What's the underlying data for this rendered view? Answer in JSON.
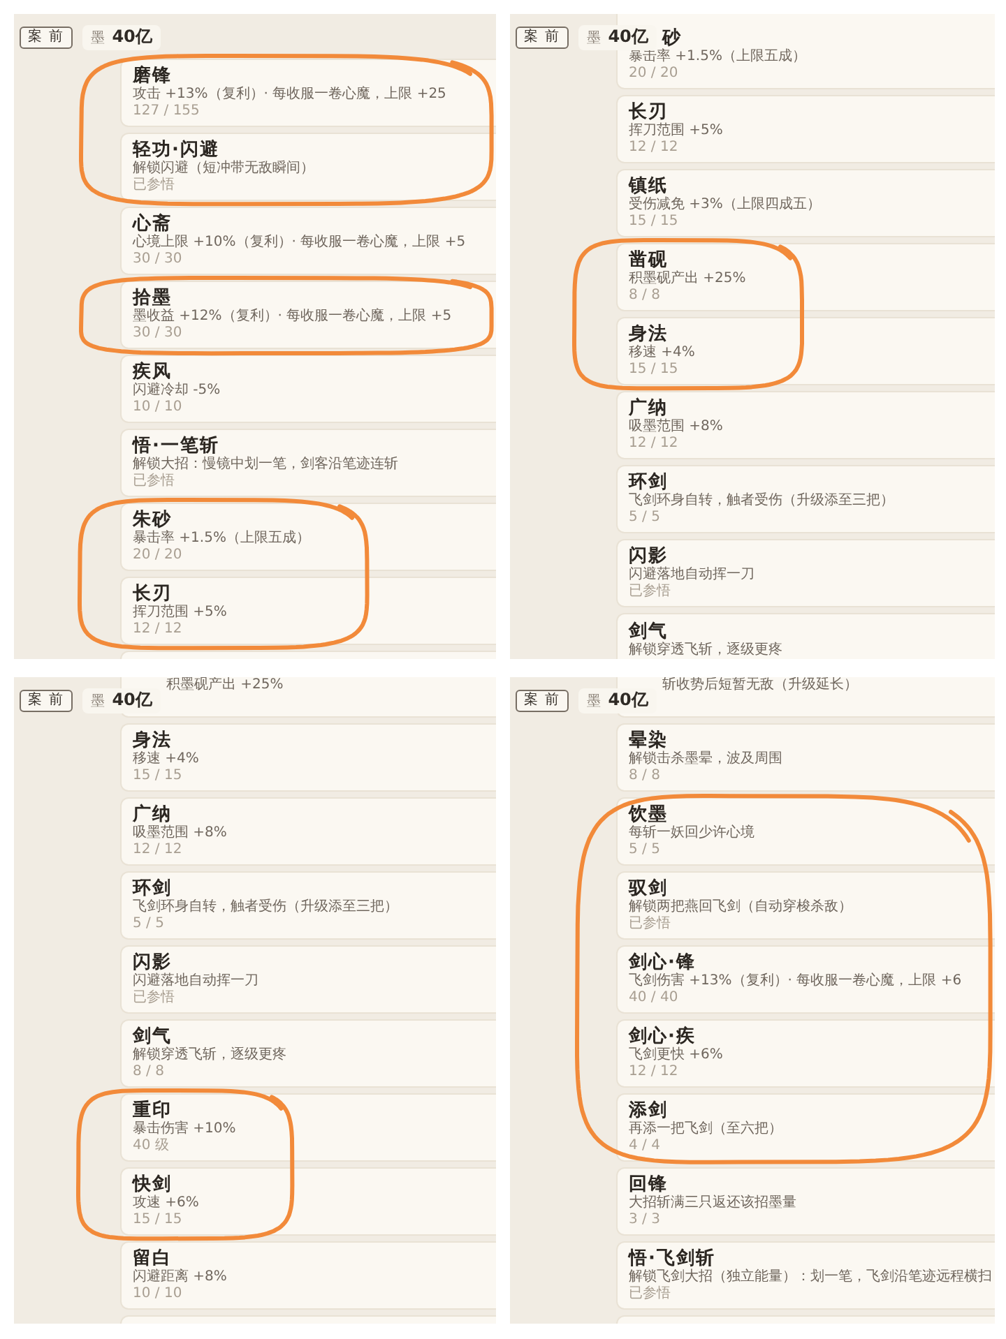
{
  "panels": [
    {
      "nav_button": "案 前",
      "ink": {
        "label": "墨",
        "amount": "40亿"
      },
      "cards": [
        {
          "kind": "full",
          "title": "磨锋",
          "desc": "攻击 +13%（复利）· 每收服一卷心魔，上限 +25",
          "progress": "127 / 155",
          "circled": true
        },
        {
          "kind": "full",
          "title": "轻功·闪避",
          "desc": "解锁闪避（短冲带无敌瞬间）",
          "progress": "已参悟",
          "circled": true
        },
        {
          "kind": "full",
          "title": "心斋",
          "desc": "心境上限 +10%（复利）· 每收服一卷心魔，上限 +5",
          "progress": "30 / 30",
          "circled": false
        },
        {
          "kind": "full",
          "title": "拾墨",
          "desc": "墨收益 +12%（复利）· 每收服一卷心魔，上限 +5",
          "progress": "30 / 30",
          "circled": true
        },
        {
          "kind": "full",
          "title": "疾风",
          "desc": "闪避冷却 -5%",
          "progress": "10 / 10",
          "circled": false
        },
        {
          "kind": "full",
          "title": "悟·一笔斩",
          "desc": "解锁大招：慢镜中划一笔，剑客沿笔迹连斩",
          "progress": "已参悟",
          "circled": false
        },
        {
          "kind": "full",
          "title": "朱砂",
          "desc": "暴击率 +1.5%（上限五成）",
          "progress": "20 / 20",
          "circled": true
        },
        {
          "kind": "full",
          "title": "长刃",
          "desc": "挥刀范围 +5%",
          "progress": "12 / 12",
          "circled": true
        },
        {
          "kind": "bottom-cut",
          "circled": false
        }
      ]
    },
    {
      "nav_button": "案 前",
      "ink": {
        "label": "墨",
        "amount": "40亿"
      },
      "cards": [
        {
          "kind": "top-cut",
          "title": "砂",
          "desc": "暴击率 +1.5%（上限五成）",
          "progress": "20 / 20",
          "circled": false
        },
        {
          "kind": "full",
          "title": "长刃",
          "desc": "挥刀范围 +5%",
          "progress": "12 / 12",
          "circled": false
        },
        {
          "kind": "full",
          "title": "镇纸",
          "desc": "受伤减免 +3%（上限四成五）",
          "progress": "15 / 15",
          "circled": false
        },
        {
          "kind": "full",
          "title": "凿砚",
          "desc": "积墨砚产出 +25%",
          "progress": "8 / 8",
          "circled": true
        },
        {
          "kind": "full",
          "title": "身法",
          "desc": "移速 +4%",
          "progress": "15 / 15",
          "circled": true
        },
        {
          "kind": "full",
          "title": "广纳",
          "desc": "吸墨范围 +8%",
          "progress": "12 / 12",
          "circled": false
        },
        {
          "kind": "full",
          "title": "环剑",
          "desc": "飞剑环身自转，触者受伤（升级添至三把）",
          "progress": "5 / 5",
          "circled": false
        },
        {
          "kind": "full",
          "title": "闪影",
          "desc": "闪避落地自动挥一刀",
          "progress": "已参悟",
          "circled": false
        },
        {
          "kind": "bottom-cut",
          "title": "剑气",
          "desc": "解锁穿透飞斩，逐级更疼",
          "circled": false
        }
      ]
    },
    {
      "nav_button": "案 前",
      "ink": {
        "label": "墨",
        "amount": "40亿"
      },
      "cards": [
        {
          "kind": "top-cut",
          "desc": "积墨砚产出 +25%",
          "circled": false
        },
        {
          "kind": "full",
          "title": "身法",
          "desc": "移速 +4%",
          "progress": "15 / 15",
          "circled": false
        },
        {
          "kind": "full",
          "title": "广纳",
          "desc": "吸墨范围 +8%",
          "progress": "12 / 12",
          "circled": false
        },
        {
          "kind": "full",
          "title": "环剑",
          "desc": "飞剑环身自转，触者受伤（升级添至三把）",
          "progress": "5 / 5",
          "circled": false
        },
        {
          "kind": "full",
          "title": "闪影",
          "desc": "闪避落地自动挥一刀",
          "progress": "已参悟",
          "circled": false
        },
        {
          "kind": "full",
          "title": "剑气",
          "desc": "解锁穿透飞斩，逐级更疼",
          "progress": "8 / 8",
          "circled": false
        },
        {
          "kind": "full",
          "title": "重印",
          "desc": "暴击伤害 +10%",
          "progress": "40 级",
          "circled": true
        },
        {
          "kind": "full",
          "title": "快剑",
          "desc": "攻速 +6%",
          "progress": "15 / 15",
          "circled": true
        },
        {
          "kind": "full",
          "title": "留白",
          "desc": "闪避距离 +8%",
          "progress": "10 / 10",
          "circled": false
        },
        {
          "kind": "bottom-cut",
          "circled": false
        }
      ]
    },
    {
      "nav_button": "案 前",
      "ink": {
        "label": "墨",
        "amount": "40亿"
      },
      "cards": [
        {
          "kind": "top-cut",
          "desc": "斩收势后短暂无敌（升级延长）",
          "circled": false
        },
        {
          "kind": "full",
          "title": "晕染",
          "desc": "解锁击杀墨晕，波及周围",
          "progress": "8 / 8",
          "circled": false
        },
        {
          "kind": "full",
          "title": "饮墨",
          "desc": "每斩一妖回少许心境",
          "progress": "5 / 5",
          "circled": true
        },
        {
          "kind": "full",
          "title": "驭剑",
          "desc": "解锁两把燕回飞剑（自动穿梭杀敌）",
          "progress": "已参悟",
          "circled": true
        },
        {
          "kind": "full",
          "title": "剑心·锋",
          "desc": "飞剑伤害 +13%（复利）· 每收服一卷心魔，上限 +6",
          "progress": "40 / 40",
          "circled": true
        },
        {
          "kind": "full",
          "title": "剑心·疾",
          "desc": "飞剑更快 +6%",
          "progress": "12 / 12",
          "circled": true
        },
        {
          "kind": "full",
          "title": "添剑",
          "desc": "再添一把飞剑（至六把）",
          "progress": "4 / 4",
          "circled": true
        },
        {
          "kind": "full",
          "title": "回锋",
          "desc": "大招斩满三只返还该招墨量",
          "progress": "3 / 3",
          "circled": false
        },
        {
          "kind": "full",
          "title": "悟·飞剑斩",
          "desc": "解锁飞剑大招（独立能量）：划一笔，飞剑沿笔迹远程横扫",
          "progress": "已参悟",
          "circled": false
        },
        {
          "kind": "bottom-cut",
          "circled": false
        }
      ]
    }
  ]
}
